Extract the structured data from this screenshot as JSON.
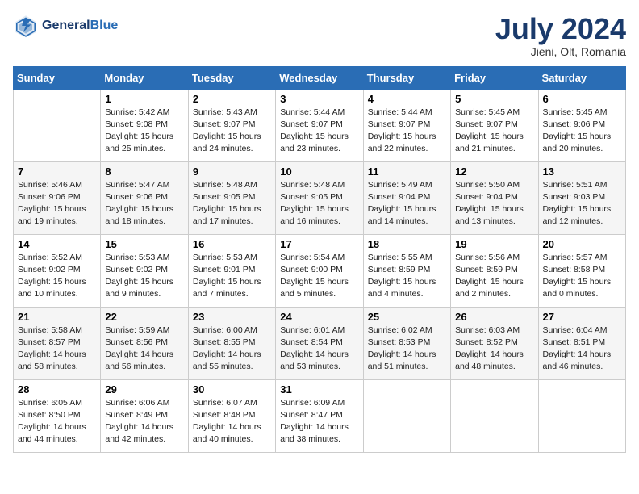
{
  "header": {
    "logo_line1": "General",
    "logo_line2": "Blue",
    "month_title": "July 2024",
    "location": "Jieni, Olt, Romania"
  },
  "weekdays": [
    "Sunday",
    "Monday",
    "Tuesday",
    "Wednesday",
    "Thursday",
    "Friday",
    "Saturday"
  ],
  "weeks": [
    [
      {
        "day": "",
        "info": ""
      },
      {
        "day": "1",
        "info": "Sunrise: 5:42 AM\nSunset: 9:08 PM\nDaylight: 15 hours\nand 25 minutes."
      },
      {
        "day": "2",
        "info": "Sunrise: 5:43 AM\nSunset: 9:07 PM\nDaylight: 15 hours\nand 24 minutes."
      },
      {
        "day": "3",
        "info": "Sunrise: 5:44 AM\nSunset: 9:07 PM\nDaylight: 15 hours\nand 23 minutes."
      },
      {
        "day": "4",
        "info": "Sunrise: 5:44 AM\nSunset: 9:07 PM\nDaylight: 15 hours\nand 22 minutes."
      },
      {
        "day": "5",
        "info": "Sunrise: 5:45 AM\nSunset: 9:07 PM\nDaylight: 15 hours\nand 21 minutes."
      },
      {
        "day": "6",
        "info": "Sunrise: 5:45 AM\nSunset: 9:06 PM\nDaylight: 15 hours\nand 20 minutes."
      }
    ],
    [
      {
        "day": "7",
        "info": "Sunrise: 5:46 AM\nSunset: 9:06 PM\nDaylight: 15 hours\nand 19 minutes."
      },
      {
        "day": "8",
        "info": "Sunrise: 5:47 AM\nSunset: 9:06 PM\nDaylight: 15 hours\nand 18 minutes."
      },
      {
        "day": "9",
        "info": "Sunrise: 5:48 AM\nSunset: 9:05 PM\nDaylight: 15 hours\nand 17 minutes."
      },
      {
        "day": "10",
        "info": "Sunrise: 5:48 AM\nSunset: 9:05 PM\nDaylight: 15 hours\nand 16 minutes."
      },
      {
        "day": "11",
        "info": "Sunrise: 5:49 AM\nSunset: 9:04 PM\nDaylight: 15 hours\nand 14 minutes."
      },
      {
        "day": "12",
        "info": "Sunrise: 5:50 AM\nSunset: 9:04 PM\nDaylight: 15 hours\nand 13 minutes."
      },
      {
        "day": "13",
        "info": "Sunrise: 5:51 AM\nSunset: 9:03 PM\nDaylight: 15 hours\nand 12 minutes."
      }
    ],
    [
      {
        "day": "14",
        "info": "Sunrise: 5:52 AM\nSunset: 9:02 PM\nDaylight: 15 hours\nand 10 minutes."
      },
      {
        "day": "15",
        "info": "Sunrise: 5:53 AM\nSunset: 9:02 PM\nDaylight: 15 hours\nand 9 minutes."
      },
      {
        "day": "16",
        "info": "Sunrise: 5:53 AM\nSunset: 9:01 PM\nDaylight: 15 hours\nand 7 minutes."
      },
      {
        "day": "17",
        "info": "Sunrise: 5:54 AM\nSunset: 9:00 PM\nDaylight: 15 hours\nand 5 minutes."
      },
      {
        "day": "18",
        "info": "Sunrise: 5:55 AM\nSunset: 8:59 PM\nDaylight: 15 hours\nand 4 minutes."
      },
      {
        "day": "19",
        "info": "Sunrise: 5:56 AM\nSunset: 8:59 PM\nDaylight: 15 hours\nand 2 minutes."
      },
      {
        "day": "20",
        "info": "Sunrise: 5:57 AM\nSunset: 8:58 PM\nDaylight: 15 hours\nand 0 minutes."
      }
    ],
    [
      {
        "day": "21",
        "info": "Sunrise: 5:58 AM\nSunset: 8:57 PM\nDaylight: 14 hours\nand 58 minutes."
      },
      {
        "day": "22",
        "info": "Sunrise: 5:59 AM\nSunset: 8:56 PM\nDaylight: 14 hours\nand 56 minutes."
      },
      {
        "day": "23",
        "info": "Sunrise: 6:00 AM\nSunset: 8:55 PM\nDaylight: 14 hours\nand 55 minutes."
      },
      {
        "day": "24",
        "info": "Sunrise: 6:01 AM\nSunset: 8:54 PM\nDaylight: 14 hours\nand 53 minutes."
      },
      {
        "day": "25",
        "info": "Sunrise: 6:02 AM\nSunset: 8:53 PM\nDaylight: 14 hours\nand 51 minutes."
      },
      {
        "day": "26",
        "info": "Sunrise: 6:03 AM\nSunset: 8:52 PM\nDaylight: 14 hours\nand 48 minutes."
      },
      {
        "day": "27",
        "info": "Sunrise: 6:04 AM\nSunset: 8:51 PM\nDaylight: 14 hours\nand 46 minutes."
      }
    ],
    [
      {
        "day": "28",
        "info": "Sunrise: 6:05 AM\nSunset: 8:50 PM\nDaylight: 14 hours\nand 44 minutes."
      },
      {
        "day": "29",
        "info": "Sunrise: 6:06 AM\nSunset: 8:49 PM\nDaylight: 14 hours\nand 42 minutes."
      },
      {
        "day": "30",
        "info": "Sunrise: 6:07 AM\nSunset: 8:48 PM\nDaylight: 14 hours\nand 40 minutes."
      },
      {
        "day": "31",
        "info": "Sunrise: 6:09 AM\nSunset: 8:47 PM\nDaylight: 14 hours\nand 38 minutes."
      },
      {
        "day": "",
        "info": ""
      },
      {
        "day": "",
        "info": ""
      },
      {
        "day": "",
        "info": ""
      }
    ]
  ]
}
